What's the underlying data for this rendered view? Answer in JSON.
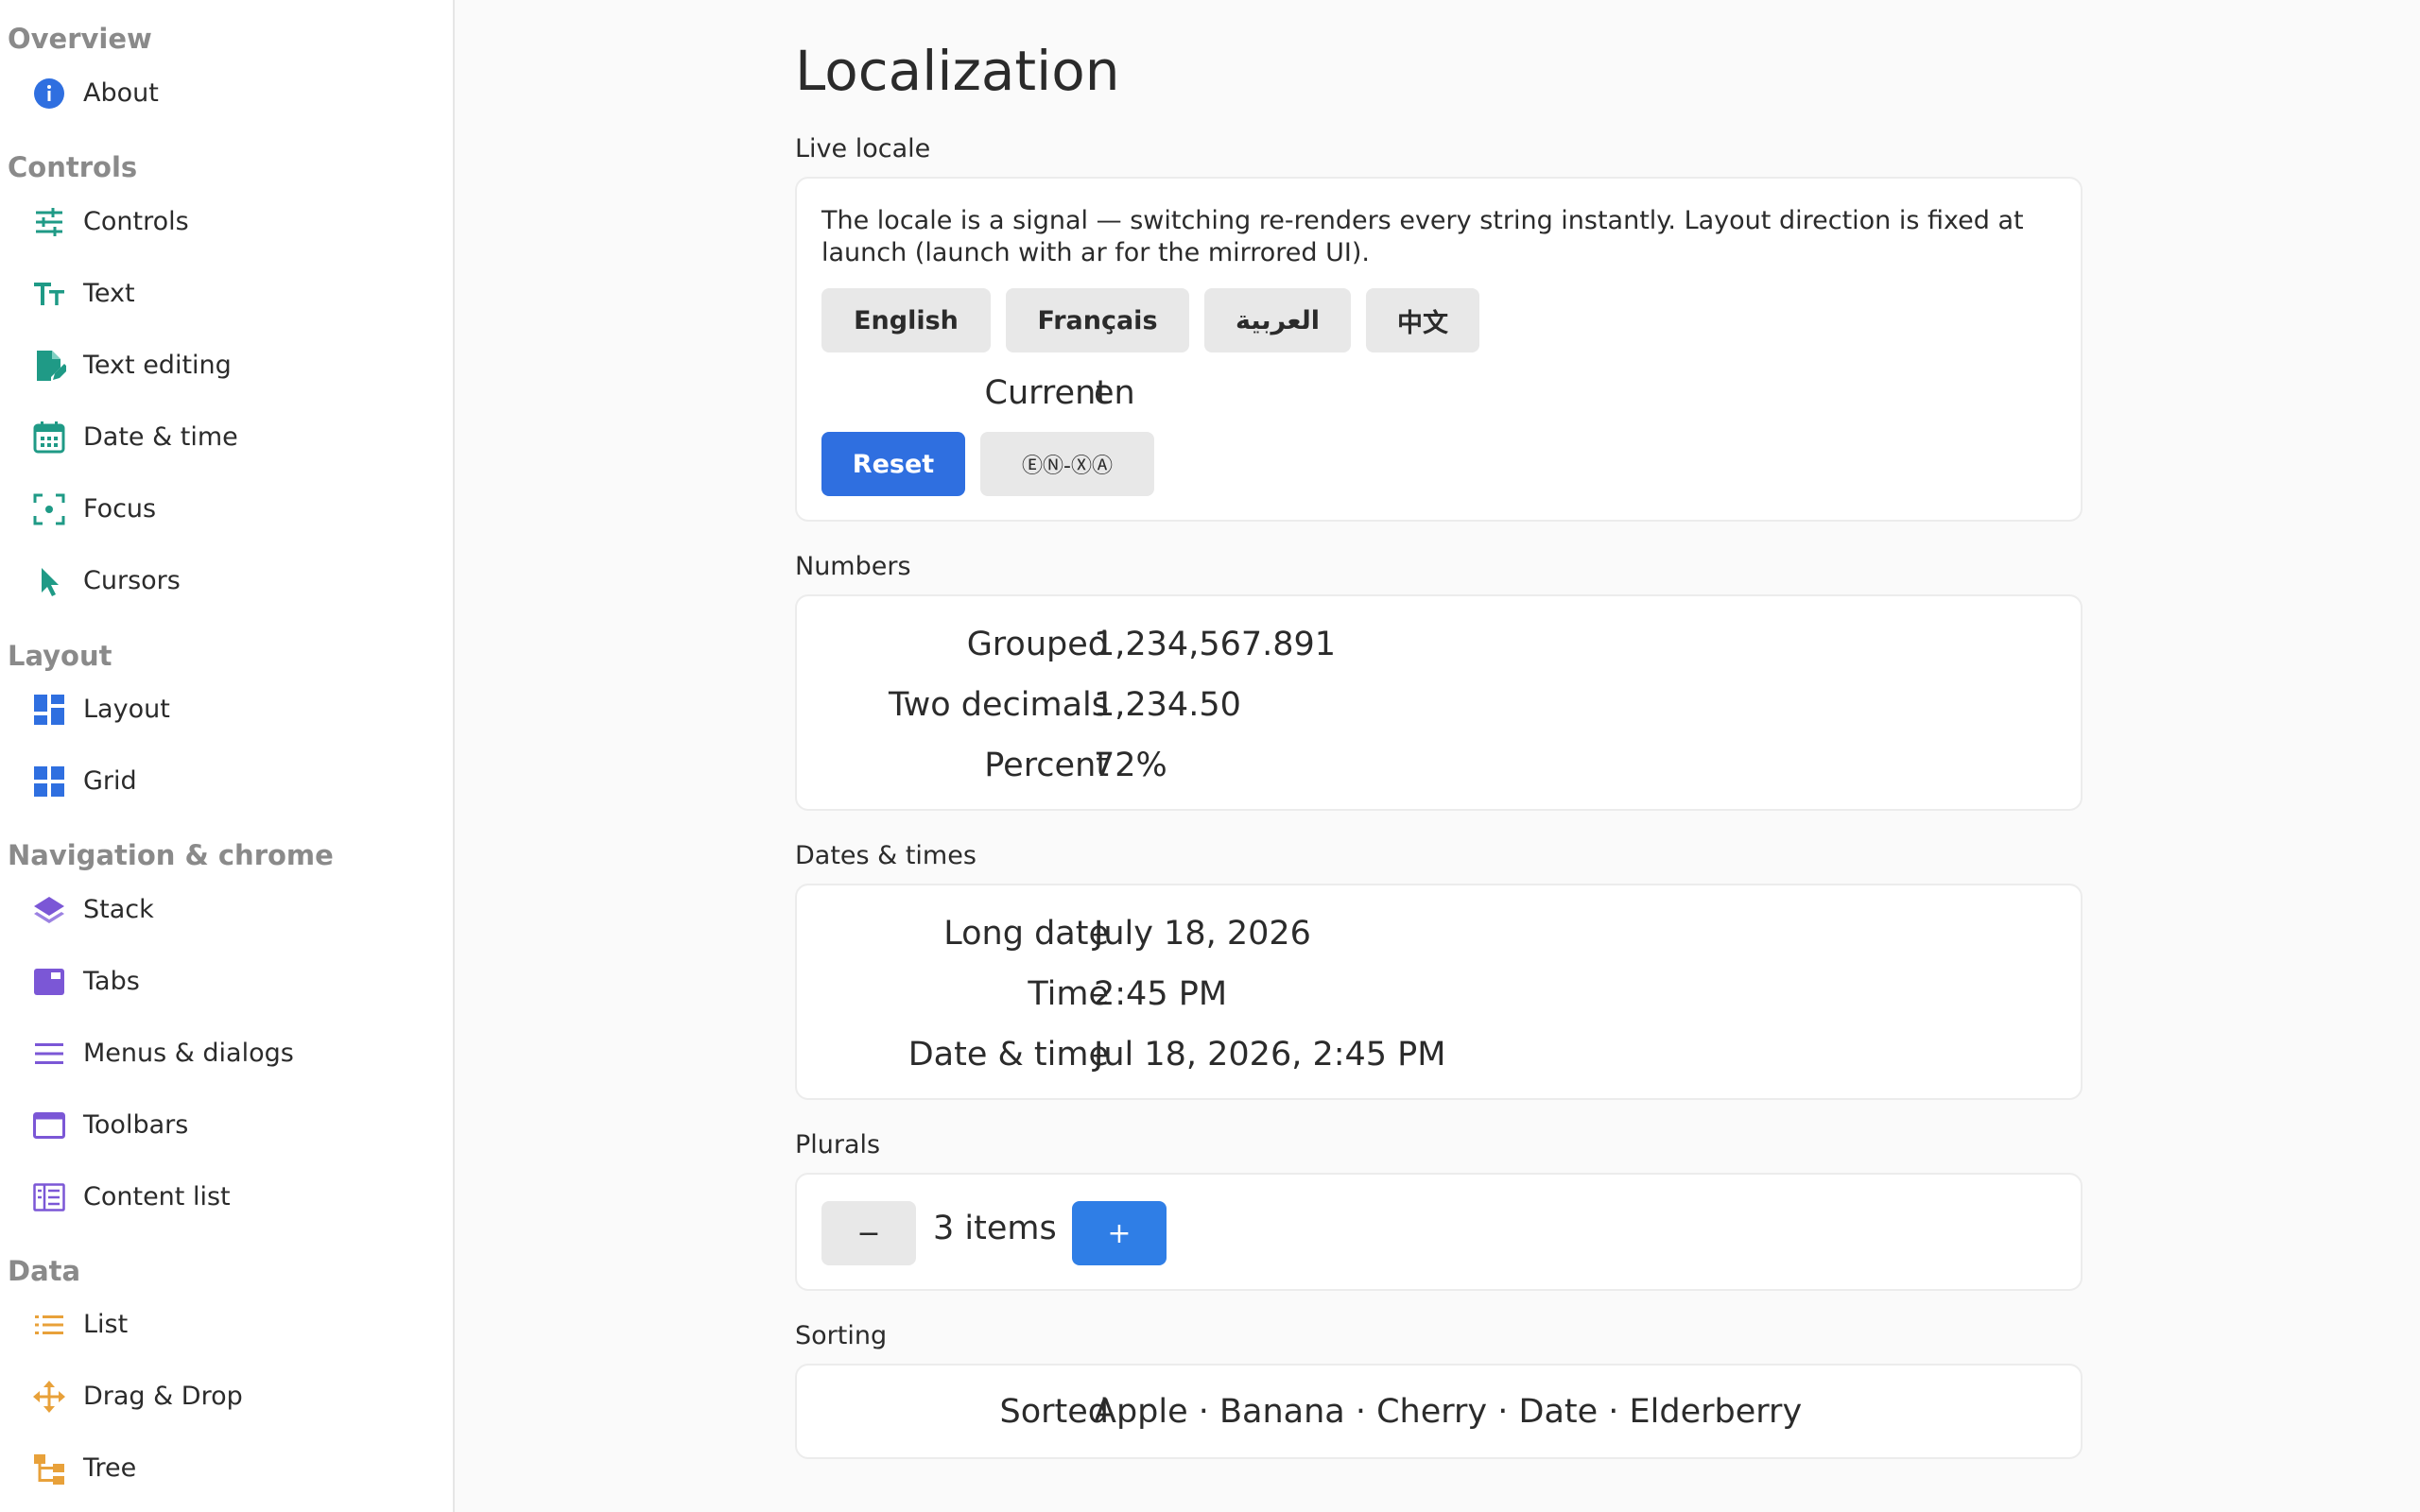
{
  "sidebar": {
    "groups": [
      {
        "heading": "Overview",
        "items": [
          {
            "label": "About",
            "icon": "info-icon"
          }
        ]
      },
      {
        "heading": "Controls",
        "items": [
          {
            "label": "Controls",
            "icon": "sliders-icon"
          },
          {
            "label": "Text",
            "icon": "text-size-icon"
          },
          {
            "label": "Text editing",
            "icon": "document-edit-icon"
          },
          {
            "label": "Date & time",
            "icon": "calendar-icon"
          },
          {
            "label": "Focus",
            "icon": "focus-icon"
          },
          {
            "label": "Cursors",
            "icon": "cursor-icon"
          }
        ]
      },
      {
        "heading": "Layout",
        "items": [
          {
            "label": "Layout",
            "icon": "layout-icon"
          },
          {
            "label": "Grid",
            "icon": "grid-icon"
          }
        ]
      },
      {
        "heading": "Navigation & chrome",
        "items": [
          {
            "label": "Stack",
            "icon": "stack-icon"
          },
          {
            "label": "Tabs",
            "icon": "tabs-icon"
          },
          {
            "label": "Menus & dialogs",
            "icon": "menu-icon"
          },
          {
            "label": "Toolbars",
            "icon": "toolbar-icon"
          },
          {
            "label": "Content list",
            "icon": "content-list-icon"
          }
        ]
      },
      {
        "heading": "Data",
        "items": [
          {
            "label": "List",
            "icon": "list-icon"
          },
          {
            "label": "Drag & Drop",
            "icon": "drag-icon"
          },
          {
            "label": "Tree",
            "icon": "tree-icon"
          }
        ]
      }
    ]
  },
  "main": {
    "title": "Localization",
    "live_locale": {
      "label": "Live locale",
      "description": "The locale is a signal — switching re-renders every string instantly. Layout direction is fixed at launch (launch with ar for the mirrored UI).",
      "languages": [
        "English",
        "Français",
        "العربية",
        "中文"
      ],
      "current_key": "Current",
      "current_value": "en",
      "reset_label": "Reset",
      "pseudo_label": "ⒺⓃ-ⓍⒶ"
    },
    "numbers": {
      "label": "Numbers",
      "rows": [
        {
          "key": "Grouped",
          "value": "1,234,567.891"
        },
        {
          "key": "Two decimals",
          "value": "1,234.50"
        },
        {
          "key": "Percent",
          "value": "72%"
        }
      ]
    },
    "dates": {
      "label": "Dates & times",
      "rows": [
        {
          "key": "Long date",
          "value": "July 18, 2026"
        },
        {
          "key": "Time",
          "value": "2:45 PM"
        },
        {
          "key": "Date & time",
          "value": "Jul 18, 2026, 2:45 PM"
        }
      ]
    },
    "plurals": {
      "label": "Plurals",
      "minus": "−",
      "count_text": "3 items",
      "plus": "+"
    },
    "sorting": {
      "label": "Sorting",
      "key": "Sorted",
      "value": "Apple · Banana · Cherry · Date · Elderberry"
    }
  },
  "colors": {
    "accent": "#2f6fe0",
    "teal_icon": "#1f9a86",
    "blue_icon": "#2f6fe0",
    "purple_icon": "#7b57d6",
    "orange_icon": "#e8a13a"
  }
}
